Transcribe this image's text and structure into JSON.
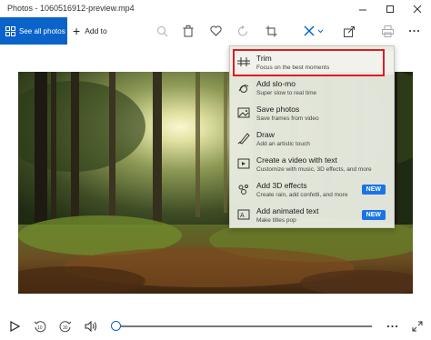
{
  "window": {
    "title": "Photos - 1060516912-preview.mp4"
  },
  "toolbar": {
    "see_all_label": "See all photos",
    "add_to_label": "Add to",
    "icons": [
      "zoom-icon",
      "delete-icon",
      "favorite-icon",
      "rotate-icon",
      "crop-icon",
      "edit-create-icon",
      "share-icon",
      "print-icon",
      "more-icon"
    ]
  },
  "menu": {
    "items": [
      {
        "title": "Trim",
        "subtitle": "Focus on the best moments",
        "icon": "trim-icon",
        "highlighted": true
      },
      {
        "title": "Add slo-mo",
        "subtitle": "Super slow to real time",
        "icon": "slomo-icon"
      },
      {
        "title": "Save photos",
        "subtitle": "Save frames from video",
        "icon": "save-photos-icon"
      },
      {
        "title": "Draw",
        "subtitle": "Add an artistic touch",
        "icon": "draw-icon"
      },
      {
        "title": "Create a video with text",
        "subtitle": "Customize with music, 3D effects, and more",
        "icon": "video-text-icon"
      },
      {
        "title": "Add 3D effects",
        "subtitle": "Create rain, add confetti, and more",
        "icon": "3d-effects-icon",
        "badge": "NEW"
      },
      {
        "title": "Add animated text",
        "subtitle": "Make titles pop",
        "icon": "animated-text-icon",
        "badge": "NEW"
      }
    ]
  },
  "player": {
    "controls": [
      "play-icon",
      "rewind-10-icon",
      "forward-30-icon",
      "volume-icon",
      "more-icon",
      "fullscreen-icon"
    ],
    "rewind_label": "10",
    "forward_label": "30",
    "progress": 0.0
  },
  "colors": {
    "accent": "#0a63c9",
    "highlight_border": "#e01b24",
    "badge": "#1a73e8"
  }
}
